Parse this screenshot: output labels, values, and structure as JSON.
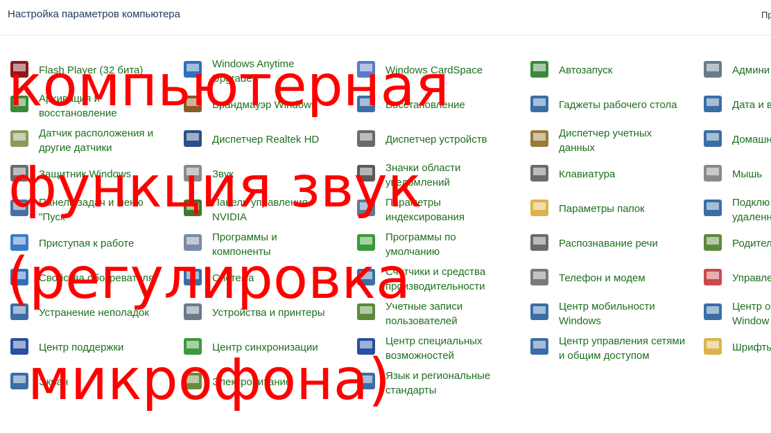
{
  "window": {
    "title": "Настройка параметров компьютера",
    "right_text": "Пр"
  },
  "columns": [
    [
      {
        "name": "flash-player",
        "icon": "flash-player-icon",
        "lines": [
          "Flash Player (32 бита)"
        ],
        "color": "#8b1a1a"
      },
      {
        "name": "archive-restore",
        "icon": "backup-restore-icon",
        "lines": [
          "Архивация и",
          "восстановление"
        ],
        "color": "#3a8a3a"
      },
      {
        "name": "location-sensors",
        "icon": "location-sensor-icon",
        "lines": [
          "Датчик расположения и",
          "другие датчики"
        ],
        "color": "#8a9a5a"
      },
      {
        "name": "windows-defender",
        "icon": "castle-wall-icon",
        "lines": [
          "Защитник Windows"
        ],
        "color": "#6a6a6a"
      },
      {
        "name": "taskbar-start",
        "icon": "taskbar-icon",
        "lines": [
          "Панель задач и меню",
          "\"Пуск\""
        ],
        "color": "#4a6fa5"
      },
      {
        "name": "getting-started",
        "icon": "getting-started-icon",
        "lines": [
          "Приступая к работе"
        ],
        "color": "#3b7ac9"
      },
      {
        "name": "browser-properties",
        "icon": "internet-options-icon",
        "lines": [
          "Свойства обозревателя"
        ],
        "color": "#2f6fbf"
      },
      {
        "name": "troubleshooting",
        "icon": "troubleshoot-icon",
        "lines": [
          "Устранение неполадок"
        ],
        "color": "#3a6ea5"
      },
      {
        "name": "action-center",
        "icon": "flag-icon",
        "lines": [
          "Центр поддержки"
        ],
        "color": "#2a4fa0"
      },
      {
        "name": "display",
        "icon": "monitor-icon",
        "lines": [
          "Экран"
        ],
        "color": "#3a6ea5"
      }
    ],
    [
      {
        "name": "windows-anytime-upgrade",
        "icon": "windows-logo-icon",
        "lines": [
          "Windows Anytime",
          "Upgrade"
        ],
        "color": "#2f6fbf"
      },
      {
        "name": "windows-firewall",
        "icon": "firewall-icon",
        "lines": [
          "Брандмауэр Windows"
        ],
        "color": "#8a5a2a"
      },
      {
        "name": "realtek-manager",
        "icon": "realtek-icon",
        "lines": [
          "Диспетчер Realtek HD"
        ],
        "color": "#2a4f8a"
      },
      {
        "name": "sound",
        "icon": "speaker-icon",
        "lines": [
          "Звук"
        ],
        "color": "#8a8a8a"
      },
      {
        "name": "nvidia-control-panel",
        "icon": "nvidia-icon",
        "lines": [
          "Панель управления",
          "NVIDIA"
        ],
        "color": "#3a7a2a"
      },
      {
        "name": "programs-features",
        "icon": "programs-icon",
        "lines": [
          "Программы и",
          "компоненты"
        ],
        "color": "#7a8aa5"
      },
      {
        "name": "system",
        "icon": "system-computer-icon",
        "lines": [
          "Система"
        ],
        "color": "#3a6ea5"
      },
      {
        "name": "devices-printers",
        "icon": "printer-icon",
        "lines": [
          "Устройства и принтеры"
        ],
        "color": "#6a7a8a"
      },
      {
        "name": "sync-center",
        "icon": "sync-icon",
        "lines": [
          "Центр синхронизации"
        ],
        "color": "#3a9a3a"
      },
      {
        "name": "power-options",
        "icon": "power-plug-icon",
        "lines": [
          "Электропитание"
        ],
        "color": "#6a8a3a"
      }
    ],
    [
      {
        "name": "windows-cardspace",
        "icon": "cardspace-icon",
        "lines": [
          "Windows CardSpace"
        ],
        "color": "#5a7ac9"
      },
      {
        "name": "recovery",
        "icon": "recovery-icon",
        "lines": [
          "Восстановление"
        ],
        "color": "#3a6ea5"
      },
      {
        "name": "device-manager",
        "icon": "device-manager-icon",
        "lines": [
          "Диспетчер устройств"
        ],
        "color": "#6a6a6a"
      },
      {
        "name": "notification-icons",
        "icon": "notification-area-icon",
        "lines": [
          "Значки области",
          "уведомлений"
        ],
        "color": "#5a5a5a"
      },
      {
        "name": "indexing-options",
        "icon": "indexing-icon",
        "lines": [
          "Параметры",
          "индексирования"
        ],
        "color": "#5a7a9a"
      },
      {
        "name": "default-programs",
        "icon": "default-programs-icon",
        "lines": [
          "Программы по",
          "умолчанию"
        ],
        "color": "#3a9a3a"
      },
      {
        "name": "performance-tools",
        "icon": "performance-icon",
        "lines": [
          "Счетчики и средства",
          "производительности"
        ],
        "color": "#3a6ea5"
      },
      {
        "name": "user-accounts",
        "icon": "users-icon",
        "lines": [
          "Учетные записи",
          "пользователей"
        ],
        "color": "#5a8a3a"
      },
      {
        "name": "ease-of-access",
        "icon": "accessibility-icon",
        "lines": [
          "Центр специальных",
          "возможностей"
        ],
        "color": "#2a4fa0"
      },
      {
        "name": "region-language",
        "icon": "globe-clock-icon",
        "lines": [
          "Язык и региональные",
          "стандарты"
        ],
        "color": "#3a6ea5"
      }
    ],
    [
      {
        "name": "autoplay",
        "icon": "autoplay-icon",
        "lines": [
          "Автозапуск"
        ],
        "color": "#3a8a3a"
      },
      {
        "name": "desktop-gadgets",
        "icon": "gadgets-icon",
        "lines": [
          "Гаджеты рабочего стола"
        ],
        "color": "#3a6ea5"
      },
      {
        "name": "credential-manager",
        "icon": "vault-icon",
        "lines": [
          "Диспетчер учетных",
          "данных"
        ],
        "color": "#9a7a3a"
      },
      {
        "name": "keyboard",
        "icon": "keyboard-icon",
        "lines": [
          "Клавиатура"
        ],
        "color": "#6a6a6a"
      },
      {
        "name": "folder-options",
        "icon": "folder-icon",
        "lines": [
          "Параметры папок"
        ],
        "color": "#d9b44a"
      },
      {
        "name": "speech-recognition",
        "icon": "microphone-icon",
        "lines": [
          "Распознавание речи"
        ],
        "color": "#6a6a6a"
      },
      {
        "name": "phone-modem",
        "icon": "telephone-icon",
        "lines": [
          "Телефон и модем"
        ],
        "color": "#7a7a7a"
      },
      {
        "name": "mobility-center",
        "icon": "mobility-center-icon",
        "lines": [
          "Центр мобильности",
          "Windows"
        ],
        "color": "#3a6ea5"
      },
      {
        "name": "network-sharing",
        "icon": "network-icon",
        "lines": [
          "Центр управления сетями",
          "и общим доступом"
        ],
        "color": "#3a6ea5"
      }
    ],
    [
      {
        "name": "administration",
        "icon": "admin-tools-icon",
        "lines": [
          "Админи"
        ],
        "color": "#6a7a8a"
      },
      {
        "name": "date-time",
        "icon": "calendar-clock-icon",
        "lines": [
          "Дата и в"
        ],
        "color": "#3a6ea5"
      },
      {
        "name": "homegroup",
        "icon": "homegroup-icon",
        "lines": [
          "Домашн"
        ],
        "color": "#3a6ea5"
      },
      {
        "name": "mouse",
        "icon": "mouse-icon",
        "lines": [
          "Мышь"
        ],
        "color": "#8a8a8a"
      },
      {
        "name": "remote-connections",
        "icon": "remote-desktop-icon",
        "lines": [
          "Подклю",
          "удаленн"
        ],
        "color": "#3a6ea5"
      },
      {
        "name": "parental-controls",
        "icon": "parental-controls-icon",
        "lines": [
          "Родител"
        ],
        "color": "#5a8a3a"
      },
      {
        "name": "color-management",
        "icon": "color-management-icon",
        "lines": [
          "Управле"
        ],
        "color": "#c94a4a"
      },
      {
        "name": "windows-update",
        "icon": "windows-update-icon",
        "lines": [
          "Центр о",
          "Window"
        ],
        "color": "#3a6ea5"
      },
      {
        "name": "fonts",
        "icon": "fonts-icon",
        "lines": [
          "Шрифты"
        ],
        "color": "#d9b44a"
      }
    ]
  ],
  "overlay": {
    "color": "#ff0000",
    "lines": [
      "компьютерная",
      "функция звук",
      "(регулировка",
      "микрофона)"
    ]
  }
}
